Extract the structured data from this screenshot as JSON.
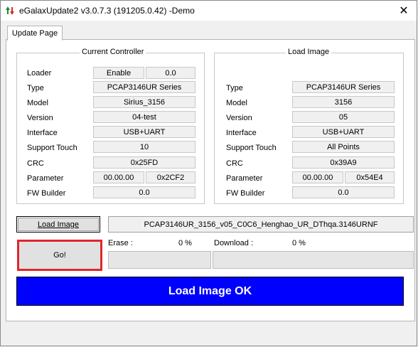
{
  "window": {
    "title": "eGalaxUpdate2 v3.0.7.3 (191205.0.42) -Demo",
    "close_glyph": "✕"
  },
  "tab": {
    "label": "Update Page"
  },
  "current_controller": {
    "title": "Current Controller",
    "loader": {
      "label": "Loader",
      "status": "Enable",
      "value": "0.0"
    },
    "type": {
      "label": "Type",
      "value": "PCAP3146UR Series"
    },
    "model": {
      "label": "Model",
      "value": "Sirius_3156"
    },
    "version": {
      "label": "Version",
      "value": "04-test"
    },
    "interface": {
      "label": "Interface",
      "value": "USB+UART"
    },
    "support_touch": {
      "label": "Support Touch",
      "value": "10"
    },
    "crc": {
      "label": "CRC",
      "value": "0x25FD"
    },
    "parameter": {
      "label": "Parameter",
      "value1": "00.00.00",
      "value2": "0x2CF2"
    },
    "fw_builder": {
      "label": "FW Builder",
      "value": "0.0"
    }
  },
  "load_image_group": {
    "title": "Load Image",
    "type": {
      "label": "Type",
      "value": "PCAP3146UR Series"
    },
    "model": {
      "label": "Model",
      "value": "3156"
    },
    "version": {
      "label": "Version",
      "value": "05"
    },
    "interface": {
      "label": "Interface",
      "value": "USB+UART"
    },
    "support_touch": {
      "label": "Support Touch",
      "value": "All Points"
    },
    "crc": {
      "label": "CRC",
      "value": "0x39A9"
    },
    "parameter": {
      "label": "Parameter",
      "value1": "00.00.00",
      "value2": "0x54E4"
    },
    "fw_builder": {
      "label": "FW Builder",
      "value": "0.0"
    }
  },
  "actions": {
    "load_image_label": "Load Image",
    "go_label": "Go!",
    "image_path": "PCAP3146UR_3156_v05_C0C6_Henghao_UR_DThqa.3146URNF"
  },
  "progress": {
    "erase_label": "Erase :",
    "erase_value": "0 %",
    "erase_fraction": 0,
    "download_label": "Download :",
    "download_value": "0 %",
    "download_fraction": 0
  },
  "status": {
    "message": "Load Image OK",
    "color": "#0000ff"
  },
  "colors": {
    "highlight_border": "#e0262c",
    "status_bg": "#0000ff"
  }
}
